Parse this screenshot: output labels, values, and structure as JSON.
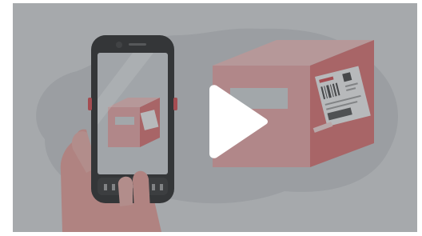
{
  "video": {
    "scene": "handheld-scanner-barcode-scan-illustration",
    "overlay_state": "paused",
    "controls": {
      "play_icon": "play-icon"
    }
  },
  "colors": {
    "background": "#d5d7d9",
    "blob": "#c3c6c8",
    "box_front": "#e7a1a0",
    "box_side": "#d8696a",
    "box_top": "#efbbba",
    "device_frame": "#1d1d1d",
    "hand": "#e59a93",
    "accent_red": "#d24348",
    "play": "#ffffff"
  }
}
